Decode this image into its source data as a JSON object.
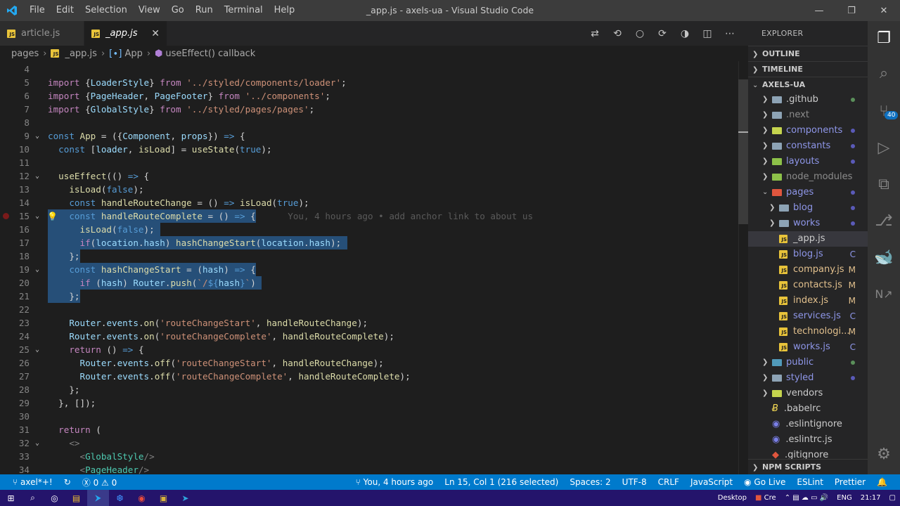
{
  "window": {
    "title": "_app.js - axels-ua - Visual Studio Code",
    "menu": [
      "File",
      "Edit",
      "Selection",
      "View",
      "Go",
      "Run",
      "Terminal",
      "Help"
    ]
  },
  "tabs": [
    {
      "label": "article.js",
      "active": false
    },
    {
      "label": "_app.js",
      "active": true
    }
  ],
  "breadcrumb": {
    "folder": "pages",
    "file": "_app.js",
    "symbol": "App",
    "callback": "useEffect() callback"
  },
  "editor": {
    "blame": "You, 4 hours ago • add anchor link to about us",
    "lines": [
      {
        "n": "4",
        "html": ""
      },
      {
        "n": "5",
        "html": "<span class=\"ctl\">import</span> {<span class=\"var\">LoaderStyle</span>} <span class=\"ctl\">from</span> <span class=\"str\">'../styled/components/loader'</span>;"
      },
      {
        "n": "6",
        "html": "<span class=\"ctl\">import</span> {<span class=\"var\">PageHeader</span>, <span class=\"var\">PageFooter</span>} <span class=\"ctl\">from</span> <span class=\"str\">'../components'</span>;"
      },
      {
        "n": "7",
        "html": "<span class=\"ctl\">import</span> {<span class=\"var\">GlobalStyle</span>} <span class=\"ctl\">from</span> <span class=\"str\">'../styled/pages/pages'</span>;"
      },
      {
        "n": "8",
        "html": ""
      },
      {
        "n": "9",
        "html": "<span class=\"kw\">const</span> <span class=\"fn\">App</span> = ({<span class=\"var\">Component</span>, <span class=\"var\">props</span>}) <span class=\"kw\">=&gt;</span> {"
      },
      {
        "n": "10",
        "html": "  <span class=\"kw\">const</span> [<span class=\"var\">loader</span>, <span class=\"fn\">isLoad</span>] = <span class=\"fn\">useState</span>(<span class=\"kw\">true</span>);"
      },
      {
        "n": "11",
        "html": ""
      },
      {
        "n": "12",
        "html": "  <span class=\"fn\">useEffect</span>(() <span class=\"kw\">=&gt;</span> {"
      },
      {
        "n": "13",
        "html": "    <span class=\"fn\">isLoad</span>(<span class=\"kw\">false</span>);"
      },
      {
        "n": "14",
        "html": "    <span class=\"kw\">const</span> <span class=\"fn\">handleRouteChange</span> = () <span class=\"kw\">=&gt;</span> <span class=\"fn\">isLoad</span>(<span class=\"kw\">true</span>);"
      },
      {
        "n": "15",
        "html": "    <span class=\"kw\">const</span> <span class=\"fn\">handleRouteComplete</span> = () <span class=\"kw\">=&gt;</span> {"
      },
      {
        "n": "16",
        "html": "      <span class=\"fn\">isLoad</span>(<span class=\"kw\">false</span>);"
      },
      {
        "n": "17",
        "html": "      <span class=\"ctl\">if</span>(<span class=\"var\">location</span>.<span class=\"var\">hash</span>) <span class=\"fn\">hashChangeStart</span>(<span class=\"var\">location</span>.<span class=\"var\">hash</span>);"
      },
      {
        "n": "18",
        "html": "    };"
      },
      {
        "n": "19",
        "html": "    <span class=\"kw\">const</span> <span class=\"fn\">hashChangeStart</span> = (<span class=\"var\">hash</span>) <span class=\"kw\">=&gt;</span> {"
      },
      {
        "n": "20",
        "html": "      <span class=\"ctl\">if</span> (<span class=\"var\">hash</span>) <span class=\"var\">Router</span>.<span class=\"fn\">push</span>(<span class=\"str\">`/</span><span class=\"kw\">${</span><span class=\"var\">hash</span><span class=\"kw\">}</span><span class=\"str\">`</span>)"
      },
      {
        "n": "21",
        "html": "    };"
      },
      {
        "n": "22",
        "html": ""
      },
      {
        "n": "23",
        "html": "    <span class=\"var\">Router</span>.<span class=\"var\">events</span>.<span class=\"fn\">on</span>(<span class=\"str\">'routeChangeStart'</span>, <span class=\"fn\">handleRouteChange</span>);"
      },
      {
        "n": "24",
        "html": "    <span class=\"var\">Router</span>.<span class=\"var\">events</span>.<span class=\"fn\">on</span>(<span class=\"str\">'routeChangeComplete'</span>, <span class=\"fn\">handleRouteComplete</span>);"
      },
      {
        "n": "25",
        "html": "    <span class=\"ctl\">return</span> () <span class=\"kw\">=&gt;</span> {"
      },
      {
        "n": "26",
        "html": "      <span class=\"var\">Router</span>.<span class=\"var\">events</span>.<span class=\"fn\">off</span>(<span class=\"str\">'routeChangeStart'</span>, <span class=\"fn\">handleRouteChange</span>);"
      },
      {
        "n": "27",
        "html": "      <span class=\"var\">Router</span>.<span class=\"var\">events</span>.<span class=\"fn\">off</span>(<span class=\"str\">'routeChangeComplete'</span>, <span class=\"fn\">handleRouteComplete</span>);"
      },
      {
        "n": "28",
        "html": "    };"
      },
      {
        "n": "29",
        "html": "  }, []);"
      },
      {
        "n": "30",
        "html": ""
      },
      {
        "n": "31",
        "html": "  <span class=\"ctl\">return</span> ("
      },
      {
        "n": "32",
        "html": "    <span class=\"punct\">&lt;&gt;</span>"
      },
      {
        "n": "33",
        "html": "      <span class=\"punct\">&lt;</span><span class=\"tag\">GlobalStyle</span><span class=\"punct\">/&gt;</span>"
      },
      {
        "n": "34",
        "html": "      <span class=\"punct\">&lt;</span><span class=\"tag\">PageHeader</span><span class=\"punct\">/&gt;</span>"
      }
    ]
  },
  "explorer": {
    "title": "EXPLORER",
    "sections": {
      "outline": "OUTLINE",
      "timeline": "TIMELINE",
      "project": "AXELS-UA",
      "npm": "NPM SCRIPTS"
    },
    "items": [
      {
        "label": ".github",
        "type": "folder",
        "depth": 0,
        "expanded": false,
        "color": "#8da3b5",
        "text_color": "#cccccc",
        "dot": "#5a8f5a"
      },
      {
        "label": ".next",
        "type": "folder",
        "depth": 0,
        "expanded": false,
        "color": "#8da3b5",
        "text_color": "#8c8c8c",
        "dot": ""
      },
      {
        "label": "components",
        "type": "folder",
        "depth": 0,
        "expanded": false,
        "color": "#c5d44e",
        "text_color": "#8e96e8",
        "dot": "#5a5ab8"
      },
      {
        "label": "constants",
        "type": "folder",
        "depth": 0,
        "expanded": false,
        "color": "#8da3b5",
        "text_color": "#8e96e8",
        "dot": "#5a5ab8"
      },
      {
        "label": "layouts",
        "type": "folder",
        "depth": 0,
        "expanded": false,
        "color": "#8dc149",
        "text_color": "#8e96e8",
        "dot": "#5a5ab8"
      },
      {
        "label": "node_modules",
        "type": "folder",
        "depth": 0,
        "expanded": false,
        "color": "#8dc149",
        "text_color": "#8c8c8c",
        "dot": ""
      },
      {
        "label": "pages",
        "type": "folder",
        "depth": 0,
        "expanded": true,
        "color": "#e0563e",
        "text_color": "#8e96e8",
        "dot": "#5a5ab8"
      },
      {
        "label": "blog",
        "type": "folder",
        "depth": 1,
        "expanded": false,
        "color": "#8da3b5",
        "text_color": "#8e96e8",
        "dot": "#5a5ab8"
      },
      {
        "label": "works",
        "type": "folder",
        "depth": 1,
        "expanded": false,
        "color": "#8da3b5",
        "text_color": "#8e96e8",
        "dot": "#5a5ab8"
      },
      {
        "label": "_app.js",
        "type": "js",
        "depth": 1,
        "selected": true,
        "text_color": "#cccccc",
        "status": ""
      },
      {
        "label": "blog.js",
        "type": "js",
        "depth": 1,
        "text_color": "#8e96e8",
        "status": "C"
      },
      {
        "label": "company.js",
        "type": "js",
        "depth": 1,
        "text_color": "#e2c08d",
        "status": "M"
      },
      {
        "label": "contacts.js",
        "type": "js",
        "depth": 1,
        "text_color": "#e2c08d",
        "status": "M"
      },
      {
        "label": "index.js",
        "type": "js",
        "depth": 1,
        "text_color": "#e2c08d",
        "status": "M"
      },
      {
        "label": "services.js",
        "type": "js",
        "depth": 1,
        "text_color": "#8e96e8",
        "status": "C"
      },
      {
        "label": "technologi...",
        "type": "js",
        "depth": 1,
        "text_color": "#e2c08d",
        "status": "M"
      },
      {
        "label": "works.js",
        "type": "js",
        "depth": 1,
        "text_color": "#8e96e8",
        "status": "C"
      },
      {
        "label": "public",
        "type": "folder",
        "depth": 0,
        "expanded": false,
        "color": "#519aba",
        "text_color": "#8e96e8",
        "dot": "#5a8f5a"
      },
      {
        "label": "styled",
        "type": "folder",
        "depth": 0,
        "expanded": false,
        "color": "#8da3b5",
        "text_color": "#8e96e8",
        "dot": "#5a5ab8"
      },
      {
        "label": "vendors",
        "type": "folder",
        "depth": 0,
        "expanded": false,
        "color": "#c5d44e",
        "text_color": "#cccccc",
        "dot": ""
      },
      {
        "label": ".babelrc",
        "type": "babel",
        "depth": 0,
        "text_color": "#cccccc",
        "status": ""
      },
      {
        "label": ".eslintignore",
        "type": "eslint",
        "depth": 0,
        "text_color": "#cccccc",
        "status": ""
      },
      {
        "label": ".eslintrc.js",
        "type": "eslint",
        "depth": 0,
        "text_color": "#cccccc",
        "status": ""
      },
      {
        "label": ".gitignore",
        "type": "git",
        "depth": 0,
        "text_color": "#cccccc",
        "status": ""
      }
    ]
  },
  "activity": {
    "scm_badge": "40"
  },
  "statusbar": {
    "branch": "axel*+!",
    "errors": "0",
    "warnings": "0",
    "blame": "You, 4 hours ago",
    "position": "Ln 15, Col 1 (216 selected)",
    "spaces": "Spaces: 2",
    "encoding": "UTF-8",
    "eol": "CRLF",
    "language": "JavaScript",
    "golive": "Go Live",
    "eslint": "ESLint",
    "prettier": "Prettier"
  },
  "taskbar": {
    "desktop": "Desktop",
    "cre": "Cre",
    "lang": "ENG",
    "time": "21:17"
  }
}
